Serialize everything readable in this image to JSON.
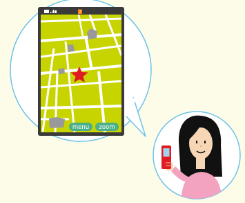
{
  "phone": {
    "status_bar": {
      "signal_icon": "signal-bars-icon",
      "battery_icon": "battery-icon",
      "alert_icon": "notification-icon",
      "alert_color": "#ff7a00"
    },
    "map": {
      "marker_icon": "star-location-icon",
      "marker_color": "#e01b24",
      "land_color": "#c8d400",
      "road_color": "#ffffff",
      "building_color": "#999999"
    },
    "buttons": {
      "menu_label": "menu",
      "zoom_label": "zoom",
      "button_color": "#4bb088"
    }
  },
  "person": {
    "icon": "woman-holding-phone-icon",
    "held_phone_color": "#e01b24"
  }
}
